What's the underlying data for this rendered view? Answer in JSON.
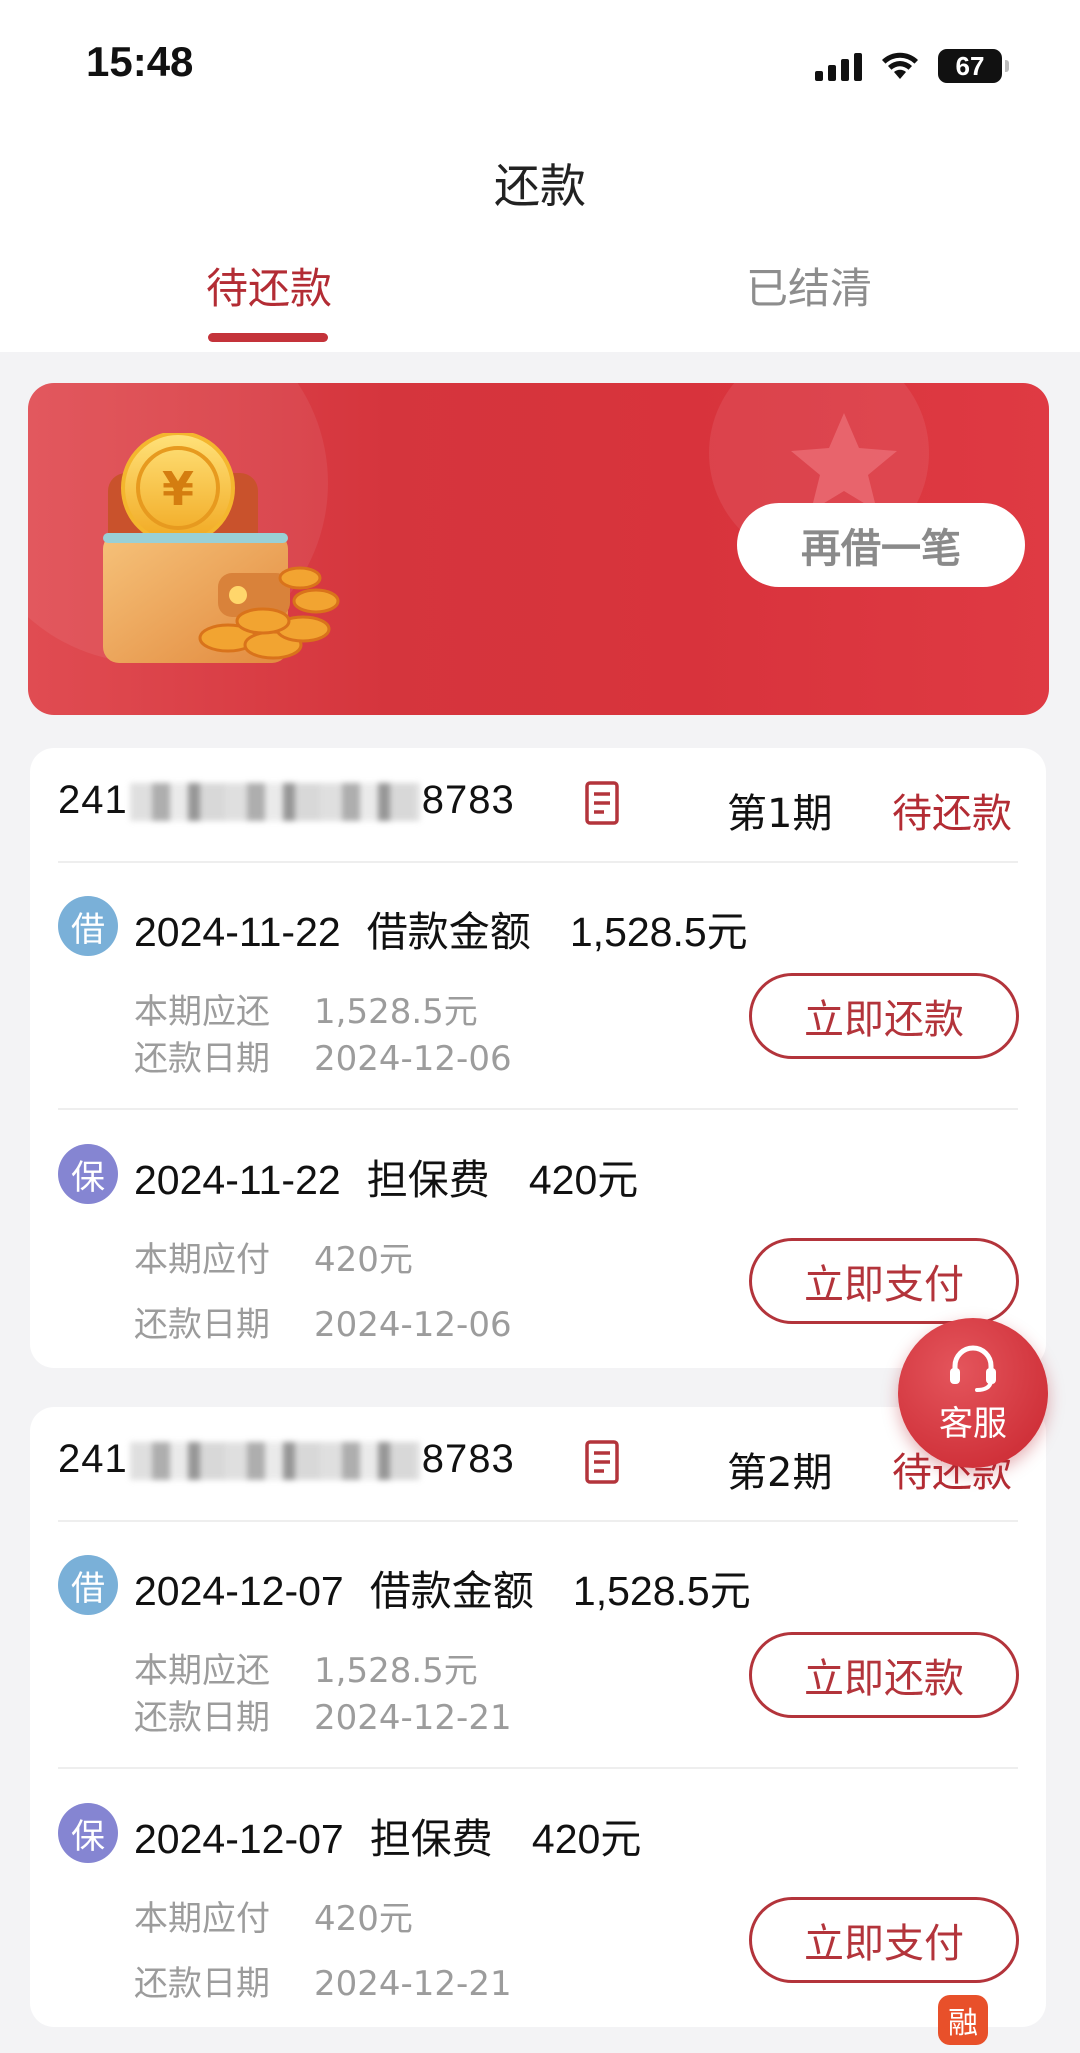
{
  "status_bar": {
    "time": "15:48",
    "battery": "67"
  },
  "header": {
    "title": "还款"
  },
  "tabs": [
    {
      "label": "待还款",
      "active": true
    },
    {
      "label": "已结清",
      "active": false
    }
  ],
  "banner": {
    "button_label": "再借一笔"
  },
  "cards": [
    {
      "order_prefix": "241",
      "order_suffix": "8783",
      "period": "第1期",
      "status": "待还款",
      "items": [
        {
          "badge": "借",
          "date": "2024-11-22",
          "title": "借款金额",
          "amount": "1,528.5元",
          "line1_label": "本期应还",
          "line1_value": "1,528.5元",
          "line2_label": "还款日期",
          "line2_value": "2024-12-06",
          "button": "立即还款"
        },
        {
          "badge": "保",
          "date": "2024-11-22",
          "title": "担保费",
          "amount": "420元",
          "line1_label": "本期应付",
          "line1_value": "420元",
          "line2_label": "还款日期",
          "line2_value": "2024-12-06",
          "button": "立即支付"
        }
      ]
    },
    {
      "order_prefix": "241",
      "order_suffix": "8783",
      "period": "第2期",
      "status": "待还款",
      "items": [
        {
          "badge": "借",
          "date": "2024-12-07",
          "title": "借款金额",
          "amount": "1,528.5元",
          "line1_label": "本期应还",
          "line1_value": "1,528.5元",
          "line2_label": "还款日期",
          "line2_value": "2024-12-21",
          "button": "立即还款"
        },
        {
          "badge": "保",
          "date": "2024-12-07",
          "title": "担保费",
          "amount": "420元",
          "line1_label": "本期应付",
          "line1_value": "420元",
          "line2_label": "还款日期",
          "line2_value": "2024-12-21",
          "button": "立即支付"
        }
      ]
    }
  ],
  "customer_service": {
    "label": "客服"
  },
  "watermark": {
    "logo_char": "融"
  },
  "colors": {
    "brand_red": "#c4333a",
    "badge_loan": "#7ab0d8",
    "badge_guarantee": "#8585d2"
  }
}
